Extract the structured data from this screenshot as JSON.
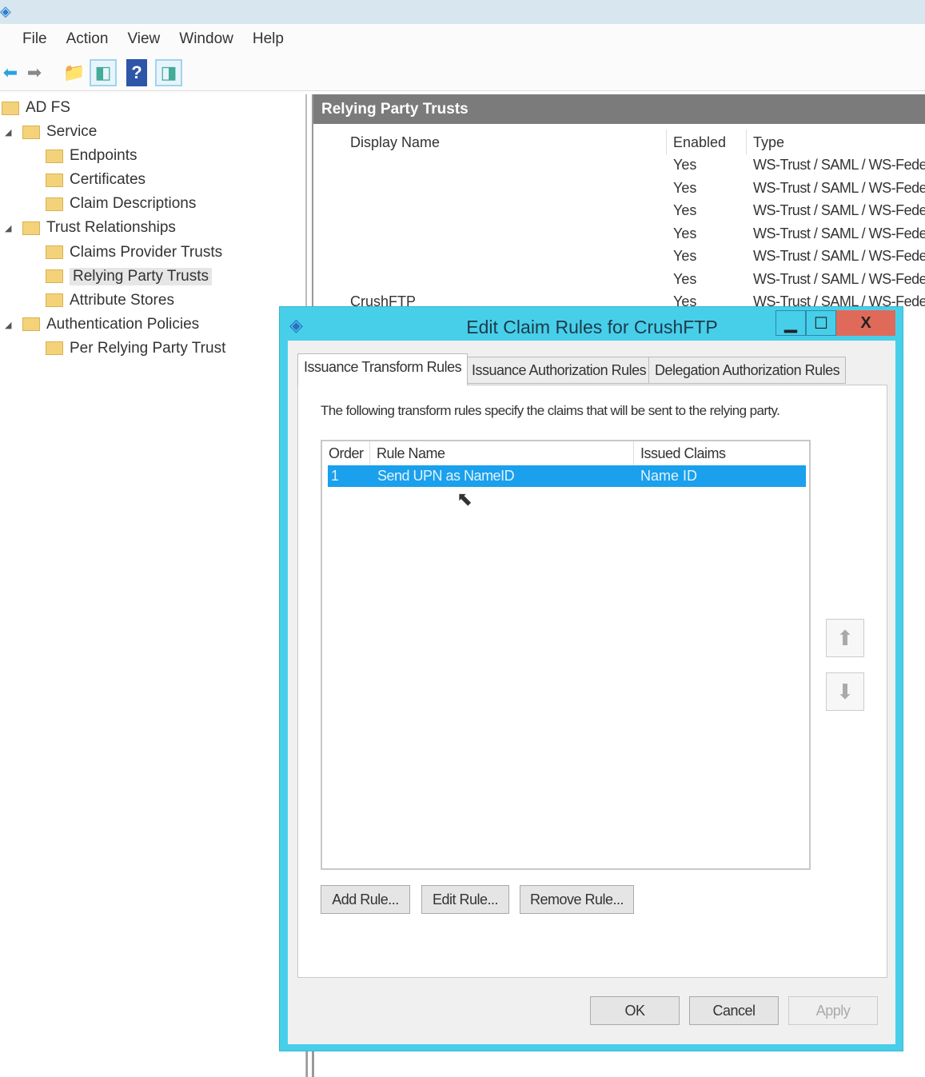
{
  "menu": [
    "File",
    "Action",
    "View",
    "Window",
    "Help"
  ],
  "tree": {
    "root": "AD FS",
    "items": [
      {
        "label": "Service",
        "level": 1,
        "expand": true
      },
      {
        "label": "Endpoints",
        "level": 2
      },
      {
        "label": "Certificates",
        "level": 2
      },
      {
        "label": "Claim Descriptions",
        "level": 2
      },
      {
        "label": "Trust Relationships",
        "level": 1,
        "expand": true
      },
      {
        "label": "Claims Provider Trusts",
        "level": 2
      },
      {
        "label": "Relying Party Trusts",
        "level": 2,
        "selected": true
      },
      {
        "label": "Attribute Stores",
        "level": 2
      },
      {
        "label": "Authentication Policies",
        "level": 1,
        "expand": true
      },
      {
        "label": "Per Relying Party Trust",
        "level": 2
      }
    ]
  },
  "rightpane": {
    "title": "Relying Party Trusts",
    "columns": [
      "Display Name",
      "Enabled",
      "Type"
    ],
    "rows": [
      {
        "name": "",
        "enabled": "Yes",
        "type": "WS-Trust / SAML / WS-Fede"
      },
      {
        "name": "",
        "enabled": "Yes",
        "type": "WS-Trust / SAML / WS-Fede"
      },
      {
        "name": "",
        "enabled": "Yes",
        "type": "WS-Trust / SAML / WS-Fede"
      },
      {
        "name": "",
        "enabled": "Yes",
        "type": "WS-Trust / SAML / WS-Fede"
      },
      {
        "name": "",
        "enabled": "Yes",
        "type": "WS-Trust / SAML / WS-Fede"
      },
      {
        "name": "",
        "enabled": "Yes",
        "type": "WS-Trust / SAML / WS-Fede"
      },
      {
        "name": "CrushFTP",
        "enabled": "Yes",
        "type": "WS-Trust / SAML / WS-Fede"
      }
    ]
  },
  "dialog": {
    "title": "Edit Claim Rules for CrushFTP",
    "close": "X",
    "tabs": [
      "Issuance Transform Rules",
      "Issuance Authorization Rules",
      "Delegation Authorization Rules"
    ],
    "description": "The following transform rules specify the claims that will be sent to the relying party.",
    "columns": [
      "Order",
      "Rule Name",
      "Issued Claims"
    ],
    "rules": [
      {
        "order": "1",
        "name": "Send UPN as NameID",
        "claims": "Name ID"
      }
    ],
    "buttons": {
      "add": "Add Rule...",
      "edit": "Edit Rule...",
      "remove": "Remove Rule...",
      "ok": "OK",
      "cancel": "Cancel",
      "apply": "Apply"
    }
  },
  "colors": {
    "dialog_frame": "#47cfea",
    "selection": "#1aa0ec",
    "close": "#e06a5a"
  }
}
